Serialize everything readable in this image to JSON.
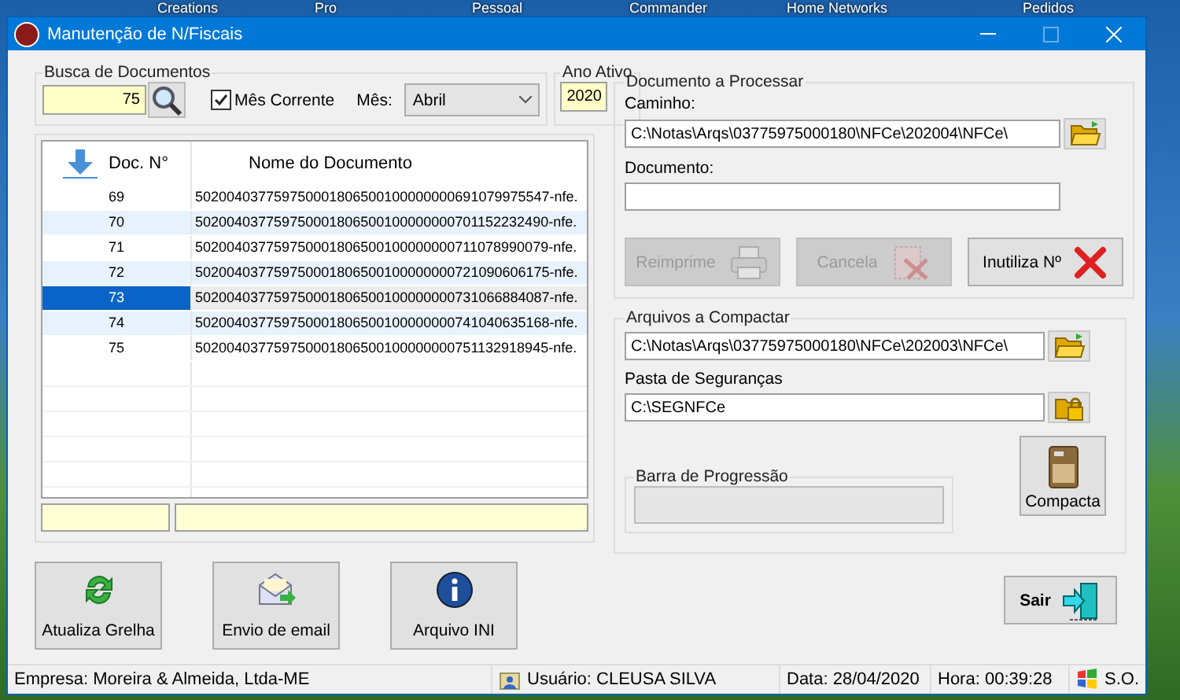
{
  "desktop": {
    "icon_labels": [
      "Creations",
      "Pro",
      "Pessoal",
      "Commander",
      "Home Networks",
      "Pedidos"
    ]
  },
  "window": {
    "title": "Manutenção de N/Fiscais"
  },
  "search": {
    "group_title": "Busca de Documentos",
    "value": "75",
    "current_month": {
      "label": "Mês Corrente",
      "checked": true
    },
    "month_label": "Mês:",
    "month": "Abril"
  },
  "active_year": {
    "title": "Ano Ativo",
    "value": "2020"
  },
  "grid": {
    "columns": [
      "Doc. N°",
      "Nome do Documento"
    ],
    "rows": [
      {
        "doc": "69",
        "name": "502004037759750001806500100000000691079975547-nfe.",
        "selected": false
      },
      {
        "doc": "70",
        "name": "502004037759750001806500100000000701152232490-nfe.",
        "selected": false
      },
      {
        "doc": "71",
        "name": "502004037759750001806500100000000711078990079-nfe.",
        "selected": false
      },
      {
        "doc": "72",
        "name": "502004037759750001806500100000000721090606175-nfe.",
        "selected": false
      },
      {
        "doc": "73",
        "name": "502004037759750001806500100000000731066884087-nfe.",
        "selected": true
      },
      {
        "doc": "74",
        "name": "502004037759750001806500100000000741040635168-nfe.",
        "selected": false
      },
      {
        "doc": "75",
        "name": "502004037759750001806500100000000751132918945-nfe.",
        "selected": false
      }
    ]
  },
  "left_buttons": [
    {
      "label": "Atualiza Grelha",
      "kind": "refresh"
    },
    {
      "label": "Envio de email",
      "kind": "email"
    },
    {
      "label": "Arquivo INI",
      "kind": "info"
    }
  ],
  "process": {
    "title": "Documento a Processar",
    "path_label": "Caminho:",
    "path": "C:\\Notas\\Arqs\\03775975000180\\NFCe\\202004\\NFCe\\",
    "document_label": "Documento:",
    "actions": [
      {
        "label": "Reimprime",
        "kind": "print",
        "disabled": true
      },
      {
        "label": "Cancela",
        "kind": "cancel",
        "disabled": true
      },
      {
        "label": "Inutiliza Nº",
        "kind": "void",
        "disabled": false
      }
    ]
  },
  "compact": {
    "title": "Arquivos a Compactar",
    "source": "C:\\Notas\\Arqs\\03775975000180\\NFCe\\202003\\NFCe\\",
    "backup_label": "Pasta de Seguranças",
    "backup": "C:\\SEGNFCe",
    "progress": {
      "title": "Barra de Progressão",
      "level": 0
    },
    "button": "Compacta"
  },
  "exit_button": "Sair",
  "status_bar": [
    {
      "kind": "text",
      "text": "Empresa: Moreira & Almeida, Ltda-ME"
    },
    {
      "kind": "user",
      "text": "Usuário: CLEUSA SILVA"
    },
    {
      "kind": "text",
      "text": "Data: 28/04/2020"
    },
    {
      "kind": "text",
      "text": "Hora: 00:39:28"
    },
    {
      "kind": "os",
      "text": "S.O."
    }
  ]
}
